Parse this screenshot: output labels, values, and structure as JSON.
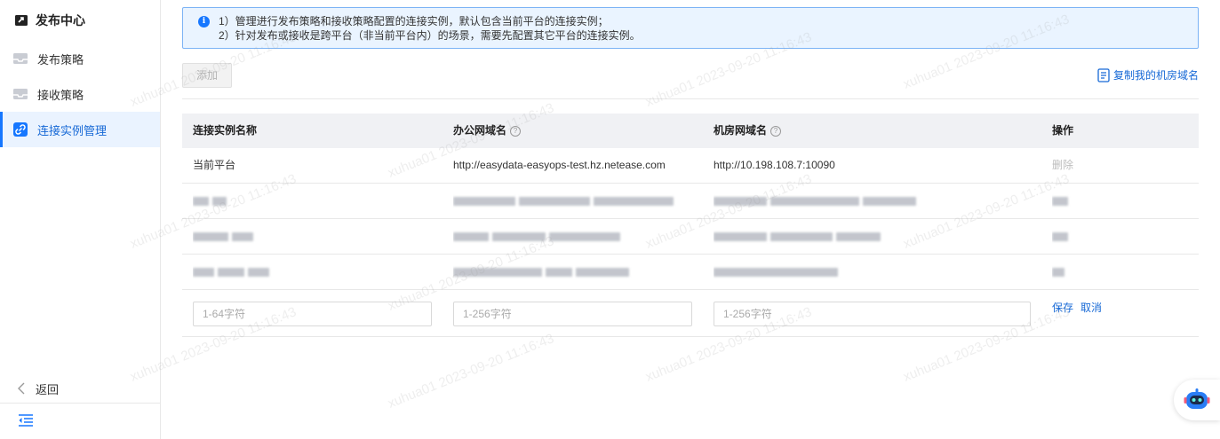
{
  "sidebar": {
    "title": "发布中心",
    "items": [
      {
        "label": "发布策略",
        "icon": "inbox-icon",
        "active": false
      },
      {
        "label": "接收策略",
        "icon": "inbox-icon",
        "active": false
      },
      {
        "label": "连接实例管理",
        "icon": "link-icon",
        "active": true
      }
    ],
    "back_label": "返回"
  },
  "notice": {
    "line1": "1）管理进行发布策略和接收策略配置的连接实例，默认包含当前平台的连接实例；",
    "line2": "2）针对发布或接收是跨平台（非当前平台内）的场景，需要先配置其它平台的连接实例。"
  },
  "toolbar": {
    "add_label": "添加",
    "copy_label": "复制我的机房域名"
  },
  "table": {
    "headers": [
      "连接实例名称",
      "办公网域名",
      "机房网域名",
      "操作"
    ],
    "rows": [
      {
        "name": "当前平台",
        "office": "http://easydata-easyops-test.hz.netease.com",
        "room": "http://10.198.108.7:10090",
        "action": "删除"
      }
    ],
    "edit_row": {
      "name_placeholder": "1-64字符",
      "office_placeholder": "1-256字符",
      "room_placeholder": "1-256字符",
      "save_label": "保存",
      "cancel_label": "取消"
    }
  },
  "watermark": "xuhua01 2023-09-20 11:16:43",
  "colors": {
    "accent": "#1677ff",
    "link": "#1769d6",
    "notice_bg": "#eaf4ff",
    "notice_border": "#7cb3f5",
    "header_bg": "#f0f1f4"
  }
}
